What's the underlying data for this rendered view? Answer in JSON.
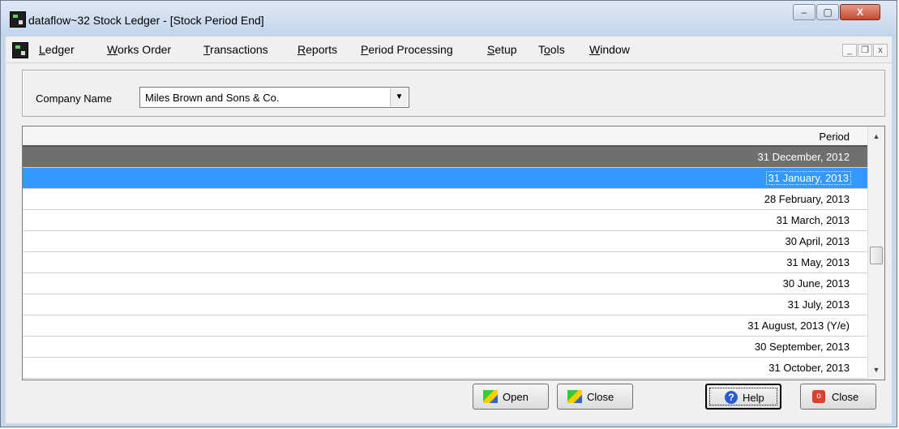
{
  "window": {
    "title": "dataflow~32 Stock Ledger - [Stock  Period End]",
    "minimize_glyph": "‒",
    "maximize_glyph": "▢",
    "close_glyph": "X"
  },
  "menubar": {
    "items": [
      {
        "label": "Ledger",
        "mnemonic": "L"
      },
      {
        "label": "Works Order",
        "mnemonic": "W"
      },
      {
        "label": "Transactions",
        "mnemonic": "T"
      },
      {
        "label": "Reports",
        "mnemonic": "R"
      },
      {
        "label": "Period Processing",
        "mnemonic": "P"
      },
      {
        "label": "Setup",
        "mnemonic": "S"
      },
      {
        "label": "Tools",
        "mnemonic": "o"
      },
      {
        "label": "Window",
        "mnemonic": "W"
      }
    ],
    "mdi_min": "_",
    "mdi_restore": "❐",
    "mdi_close": "x"
  },
  "company": {
    "label": "Company Name",
    "value": "Miles Brown and Sons & Co.",
    "arrow": "▼"
  },
  "grid": {
    "header": "Period",
    "rows": [
      "31 December, 2012",
      "31 January, 2013",
      "28 February, 2013",
      "31 March, 2013",
      "30 April, 2013",
      "31 May, 2013",
      "30 June, 2013",
      "31 July, 2013",
      "31 August, 2013 (Y/e)",
      "30 September, 2013",
      "31 October, 2013"
    ],
    "row_states": [
      "dark",
      "selected",
      "",
      "",
      "",
      "",
      "",
      "",
      "",
      "",
      ""
    ],
    "scroll_up": "▲",
    "scroll_down": "▼"
  },
  "buttons": {
    "open": "Open",
    "close_period": "Close",
    "help": "Help",
    "help_icon": "?",
    "close": "Close",
    "close_icon": "o"
  },
  "colors": {
    "selected_row": "#3399ff",
    "dark_row": "#6f6f6f",
    "close_button": "#c24a32"
  },
  "icons": {
    "app": "app-icon",
    "open": "open-period-icon",
    "close_period": "close-period-icon",
    "help": "help-icon",
    "close": "close-icon"
  }
}
